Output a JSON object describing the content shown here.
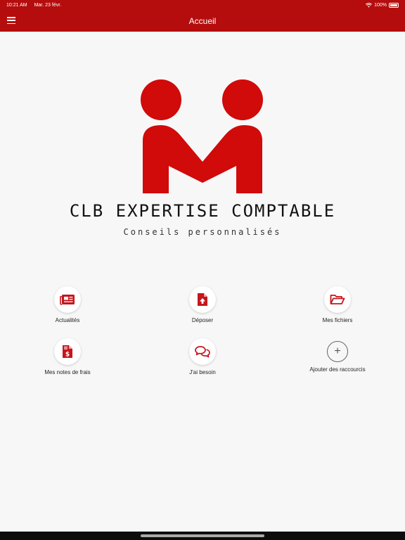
{
  "status_bar": {
    "time": "10:21 AM",
    "date": "Mar. 23 févr.",
    "battery": "100%"
  },
  "nav": {
    "title": "Accueil"
  },
  "brand": {
    "name": "CLB EXPERTISE COMPTABLE",
    "tagline": "Conseils personnalisés"
  },
  "shortcuts": [
    {
      "label": "Actualités",
      "icon": "newspaper-icon"
    },
    {
      "label": "Déposer",
      "icon": "file-upload-icon"
    },
    {
      "label": "Mes fichiers",
      "icon": "folder-open-icon"
    },
    {
      "label": "Mes notes de frais",
      "icon": "invoice-dollar-icon"
    },
    {
      "label": "J'ai besoin",
      "icon": "chat-bubbles-icon"
    },
    {
      "label": "Ajouter des raccourcis",
      "icon": "plus-icon"
    }
  ],
  "colors": {
    "brand_red": "#b50d0d",
    "logo_red": "#d10a0a",
    "background": "#f7f7f7"
  }
}
